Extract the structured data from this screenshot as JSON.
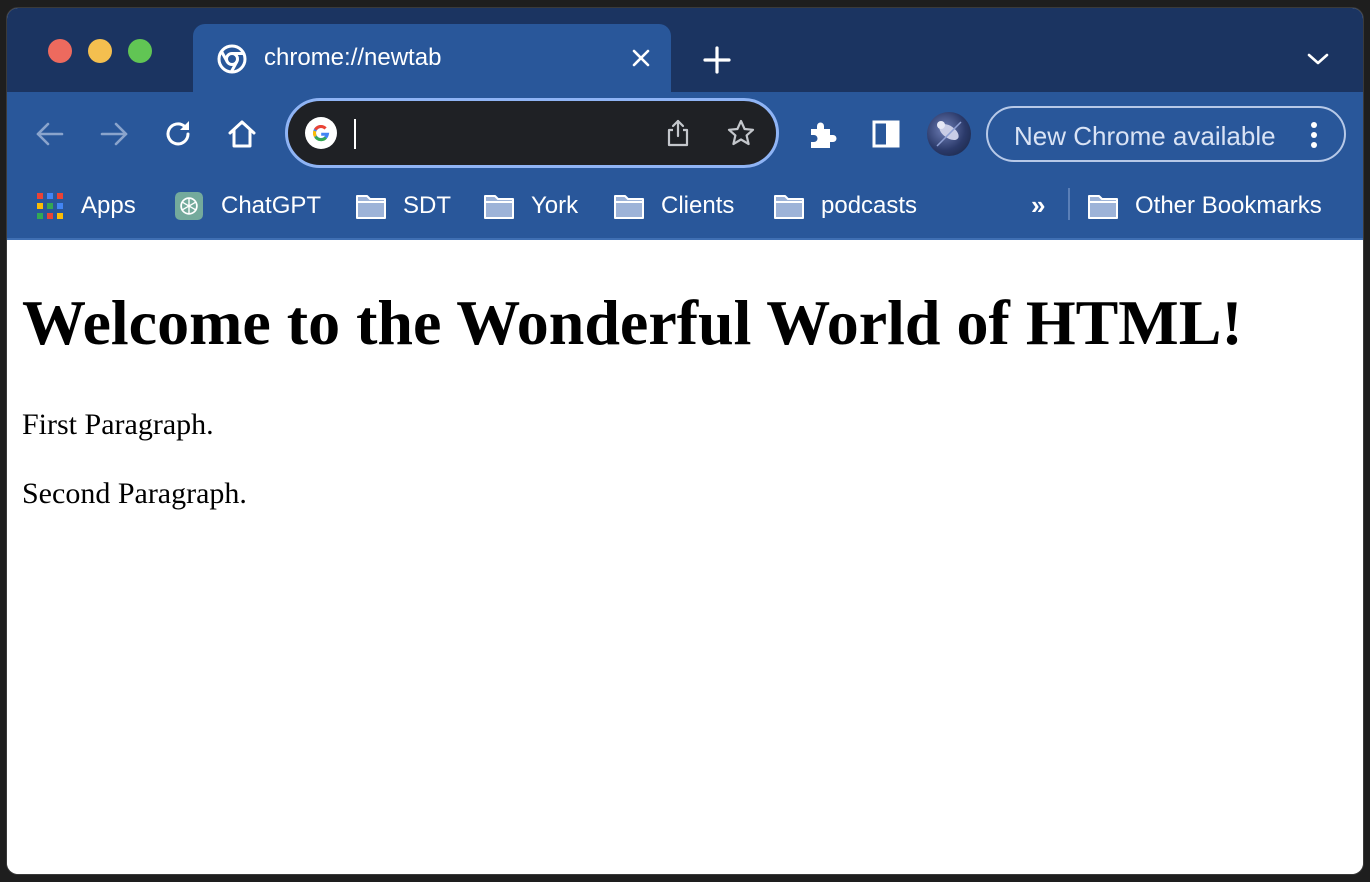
{
  "tab": {
    "title": "chrome://newtab"
  },
  "omnibox": {
    "value": ""
  },
  "update": {
    "label": "New Chrome available"
  },
  "bookmarks": {
    "items": [
      {
        "label": "Apps",
        "icon": "apps-grid-icon"
      },
      {
        "label": "ChatGPT",
        "icon": "chatgpt-icon"
      },
      {
        "label": "SDT",
        "icon": "folder-icon"
      },
      {
        "label": "York",
        "icon": "folder-icon"
      },
      {
        "label": "Clients",
        "icon": "folder-icon"
      },
      {
        "label": "podcasts",
        "icon": "folder-icon"
      }
    ],
    "overflow": "»",
    "other": "Other Bookmarks"
  },
  "page": {
    "heading": "Welcome to the Wonderful World of HTML!",
    "paragraphs": [
      "First Paragraph.",
      "Second Paragraph."
    ]
  },
  "colors": {
    "tabstrip": "#1b3461",
    "toolbar": "#29579a",
    "omnibox_border": "#8fb4f5",
    "omnibox_bg": "#1f2125"
  }
}
